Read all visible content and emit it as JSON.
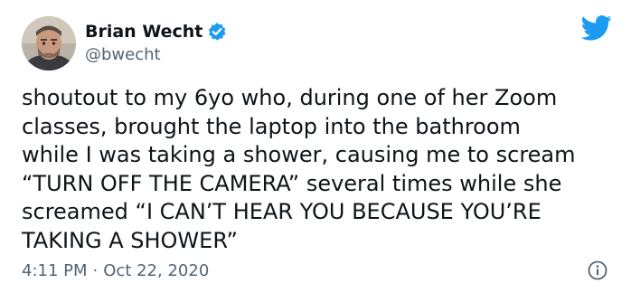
{
  "author": {
    "display_name": "Brian Wecht",
    "handle": "@bwecht",
    "verified": true,
    "avatar_icon": "profile-photo"
  },
  "tweet": {
    "text_lines": [
      "shoutout to my 6yo who, during one of her Zoom",
      "classes, brought the laptop into the bathroom",
      "while I was taking a shower, causing me to scream",
      "“TURN OFF THE CAMERA” several times while she",
      "screamed “I CAN’T HEAR YOU BECAUSE YOU’RE",
      "TAKING A SHOWER”"
    ],
    "time": "4:11 PM",
    "separator": "·",
    "date": "Oct 22, 2020"
  },
  "icons": {
    "brand": "twitter-bird-icon",
    "verified": "verified-badge-icon",
    "info": "info-icon"
  },
  "colors": {
    "brand_blue": "#1d9bf0",
    "text_primary": "#0f1419",
    "text_secondary": "#536471",
    "background": "#ffffff"
  }
}
